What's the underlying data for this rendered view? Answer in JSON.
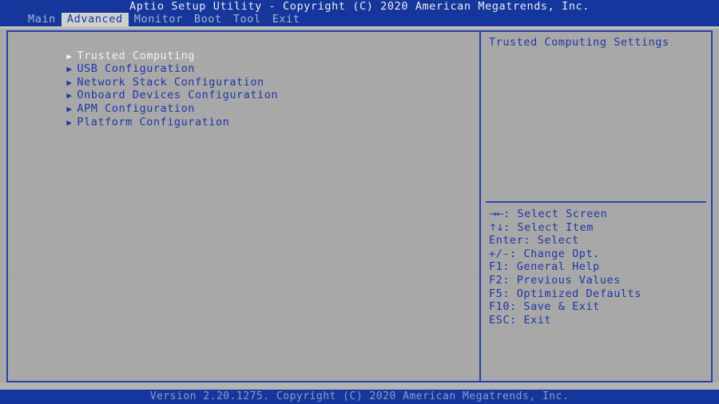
{
  "header": {
    "title": "Aptio Setup Utility - Copyright (C) 2020 American Megatrends, Inc.",
    "tabs": [
      {
        "label": "Main",
        "active": false
      },
      {
        "label": "Advanced",
        "active": true
      },
      {
        "label": "Monitor",
        "active": false
      },
      {
        "label": "Boot",
        "active": false
      },
      {
        "label": "Tool",
        "active": false
      },
      {
        "label": "Exit",
        "active": false
      }
    ]
  },
  "menu": {
    "items": [
      {
        "label": "Trusted Computing",
        "arrow": "▶",
        "selected": true
      },
      {
        "label": "USB Configuration",
        "arrow": "▶",
        "selected": false
      },
      {
        "label": "Network Stack Configuration",
        "arrow": "▶",
        "selected": false
      },
      {
        "label": "Onboard Devices Configuration",
        "arrow": "▶",
        "selected": false
      },
      {
        "label": "APM Configuration",
        "arrow": "▶",
        "selected": false
      },
      {
        "label": "Platform Configuration",
        "arrow": "▶",
        "selected": false
      }
    ]
  },
  "help": {
    "description": "Trusted Computing Settings",
    "keys": [
      {
        "glyph": "→←",
        "text": ": Select Screen"
      },
      {
        "glyph": "↑↓",
        "text": ": Select Item"
      },
      {
        "glyph": "",
        "text": "Enter: Select"
      },
      {
        "glyph": "",
        "text": "+/-: Change Opt."
      },
      {
        "glyph": "",
        "text": "F1: General Help"
      },
      {
        "glyph": "",
        "text": "F2: Previous Values"
      },
      {
        "glyph": "",
        "text": "F5: Optimized Defaults"
      },
      {
        "glyph": "",
        "text": "F10: Save & Exit"
      },
      {
        "glyph": "",
        "text": "ESC: Exit"
      }
    ]
  },
  "footer": {
    "version": "Version 2.20.1275. Copyright (C) 2020 American Megatrends, Inc."
  },
  "colors": {
    "header_blue": "#13359c",
    "body_gray": "#a9a9a9",
    "text_blue": "#1b37a8",
    "border_blue": "#1f3fae",
    "selected_text": "#f4f4f4",
    "tab_active_bg": "#d2d2d2"
  }
}
